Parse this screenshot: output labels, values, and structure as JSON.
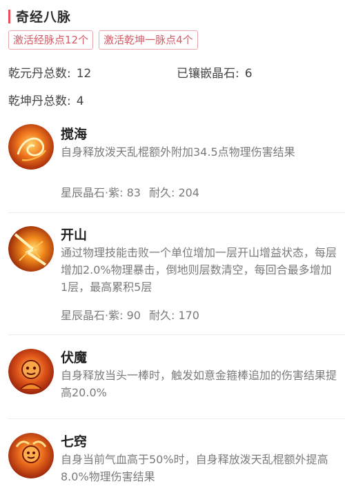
{
  "header": {
    "title": "奇经八脉"
  },
  "tags": [
    {
      "label": "激活经脉点12个"
    },
    {
      "label": "激活乾坤一脉点4个"
    }
  ],
  "stats": {
    "qianyuan": {
      "label": "乾元丹总数:",
      "value": "12"
    },
    "jingshi": {
      "label": "已镶嵌晶石:",
      "value": "6"
    },
    "qiankun": {
      "label": "乾坤丹总数:",
      "value": "4"
    }
  },
  "skills": [
    {
      "name": "搅海",
      "icon": "swirl-fire-icon",
      "description": "自身释放泼天乱棍额外附加34.5点物理伤害结果",
      "gem_label": "星辰晶石·紫:",
      "gem_value": "83",
      "durability_label": "耐久:",
      "durability_value": "204"
    },
    {
      "name": "开山",
      "icon": "mountain-crack-icon",
      "description": "通过物理技能击败一个单位增加一层开山增益状态，每层增加2.0%物理暴击，倒地则层数清空，每回合最多增加1层，最高累积5层",
      "gem_label": "星辰晶石·紫:",
      "gem_value": "90",
      "durability_label": "耐久:",
      "durability_value": "170"
    },
    {
      "name": "伏魔",
      "icon": "monkey-demon-icon",
      "description": "自身释放当头一棒时，触发如意金箍棒追加的伤害结果提高20.0%"
    },
    {
      "name": "七窍",
      "icon": "fiery-monkey-icon",
      "description": "自身当前气血高于50%时，自身释放泼天乱棍额外提高8.0%物理伤害结果"
    }
  ]
}
